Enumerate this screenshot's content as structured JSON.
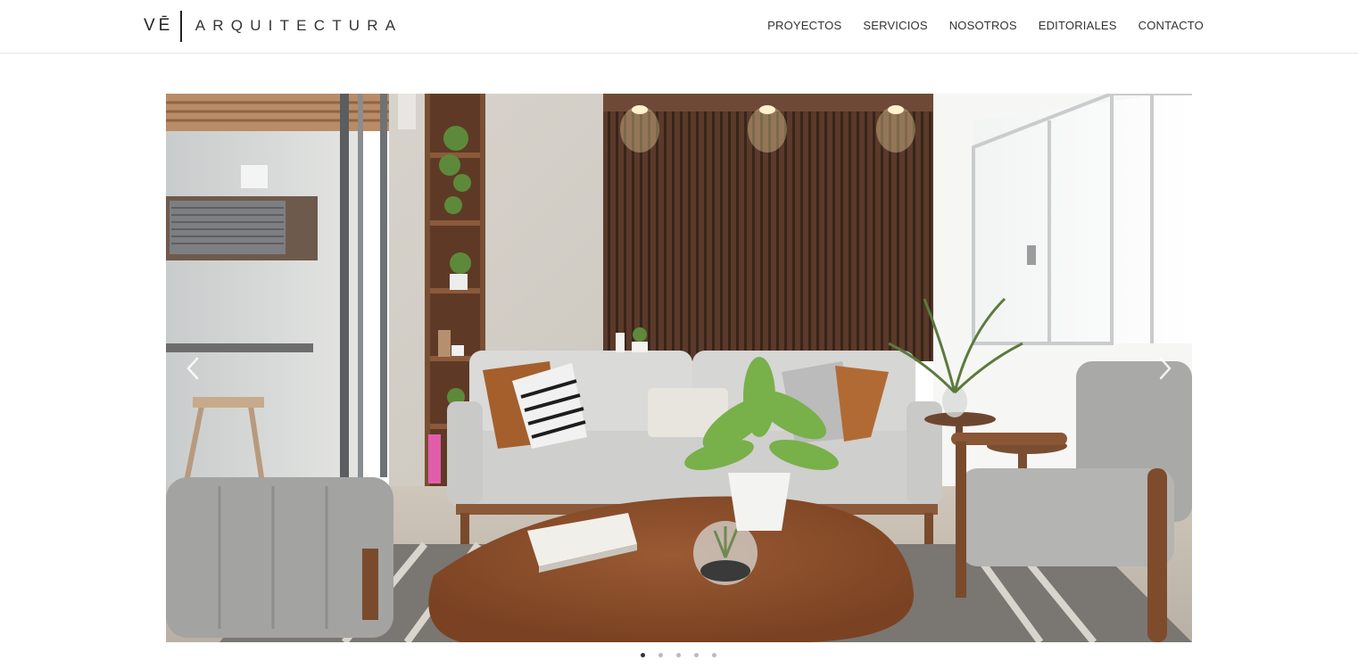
{
  "brand": {
    "mark": "VĒ",
    "name": "ARQUITECTURA"
  },
  "nav": {
    "items": [
      {
        "label": "PROYECTOS"
      },
      {
        "label": "SERVICIOS"
      },
      {
        "label": "NOSOTROS"
      },
      {
        "label": "EDITORIALES"
      },
      {
        "label": "CONTACTO"
      }
    ]
  },
  "slider": {
    "image": "living-room-interior-photo",
    "prev_icon": "chevron-left-icon",
    "next_icon": "chevron-right-icon",
    "slide_count": 5,
    "active_slide": 1
  },
  "colors": {
    "text": "#333333",
    "dot_active": "#333333",
    "dot_inactive": "#bbbbbb"
  }
}
